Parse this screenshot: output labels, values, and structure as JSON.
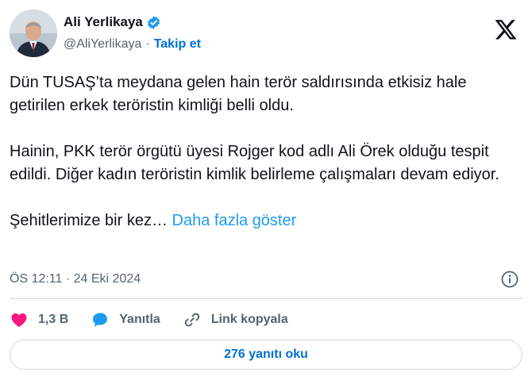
{
  "author": {
    "display_name": "Ali Yerlikaya",
    "handle": "@AliYerlikaya",
    "separator": "·",
    "follow_label": "Takip et",
    "verified": true
  },
  "tweet": {
    "paragraph_1": "Dün TUSAŞ’ta meydana gelen hain terör saldırısında etkisiz hale getirilen erkek teröristin kimliği belli oldu.",
    "paragraph_2": "Hainin, PKK terör örgütü üyesi Rojger kod adlı Ali Örek olduğu tespit edildi. Diğer kadın teröristin kimlik belirleme çalışmaları devam ediyor.",
    "paragraph_3": "Şehitlerimize bir kez…",
    "show_more": "Daha fazla göster"
  },
  "meta": {
    "timestamp": "ÖS 12:11 · 24 Eki 2024"
  },
  "actions": {
    "like_count": "1,3 B",
    "reply_label": "Yanıtla",
    "copy_link_label": "Link kopyala"
  },
  "replies_button_label": "276 yanıtı oku",
  "icons": {
    "logo": "x-logo-icon",
    "verified": "verified-badge-icon",
    "info": "info-icon",
    "like": "heart-icon",
    "reply": "speech-bubble-icon",
    "link": "link-icon"
  },
  "colors": {
    "text": "#0f1419",
    "secondary": "#536471",
    "link": "#006fd6",
    "show_more": "#1d9bf0",
    "like": "#f91880",
    "verified": "#1d9bf0",
    "border": "#cfd9de"
  }
}
